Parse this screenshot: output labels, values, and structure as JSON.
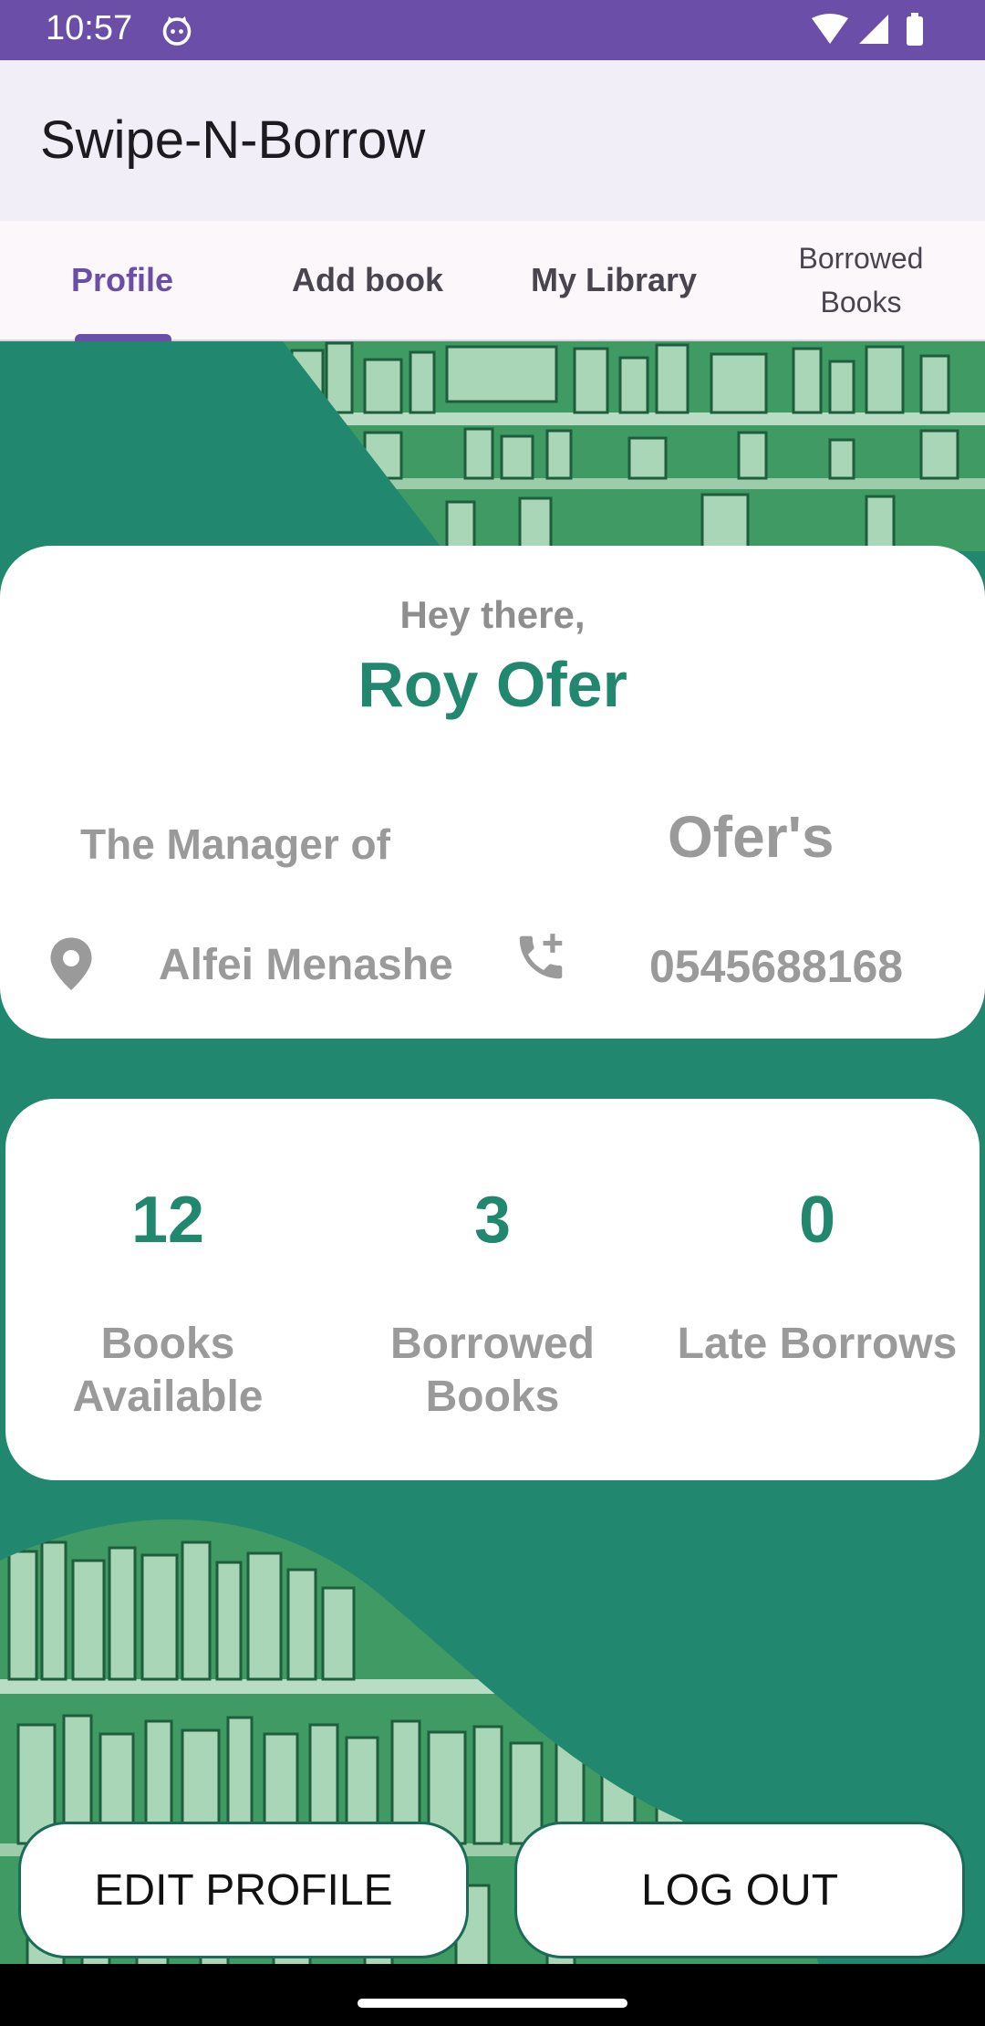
{
  "status_bar": {
    "time": "10:57"
  },
  "app_bar": {
    "title": "Swipe-N-Borrow"
  },
  "tabs": [
    {
      "label": "Profile"
    },
    {
      "label": "Add book"
    },
    {
      "label": "My Library"
    },
    {
      "label": "Borrowed Books"
    }
  ],
  "profile": {
    "greeting": "Hey there,",
    "name": "Roy Ofer",
    "role_text": "The Manager of",
    "library_name": "Ofer's",
    "location": "Alfei Menashe",
    "phone": "0545688168"
  },
  "stats": [
    {
      "value": "12",
      "label": "Books Available"
    },
    {
      "value": "3",
      "label": "Borrowed Books"
    },
    {
      "value": "0",
      "label": "Late Borrows"
    }
  ],
  "actions": {
    "edit_profile": "EDIT PROFILE",
    "log_out": "LOG OUT"
  },
  "colors": {
    "primary": "#6a4ea8",
    "accent_green": "#21876f",
    "muted_text": "#9a9a9a"
  }
}
